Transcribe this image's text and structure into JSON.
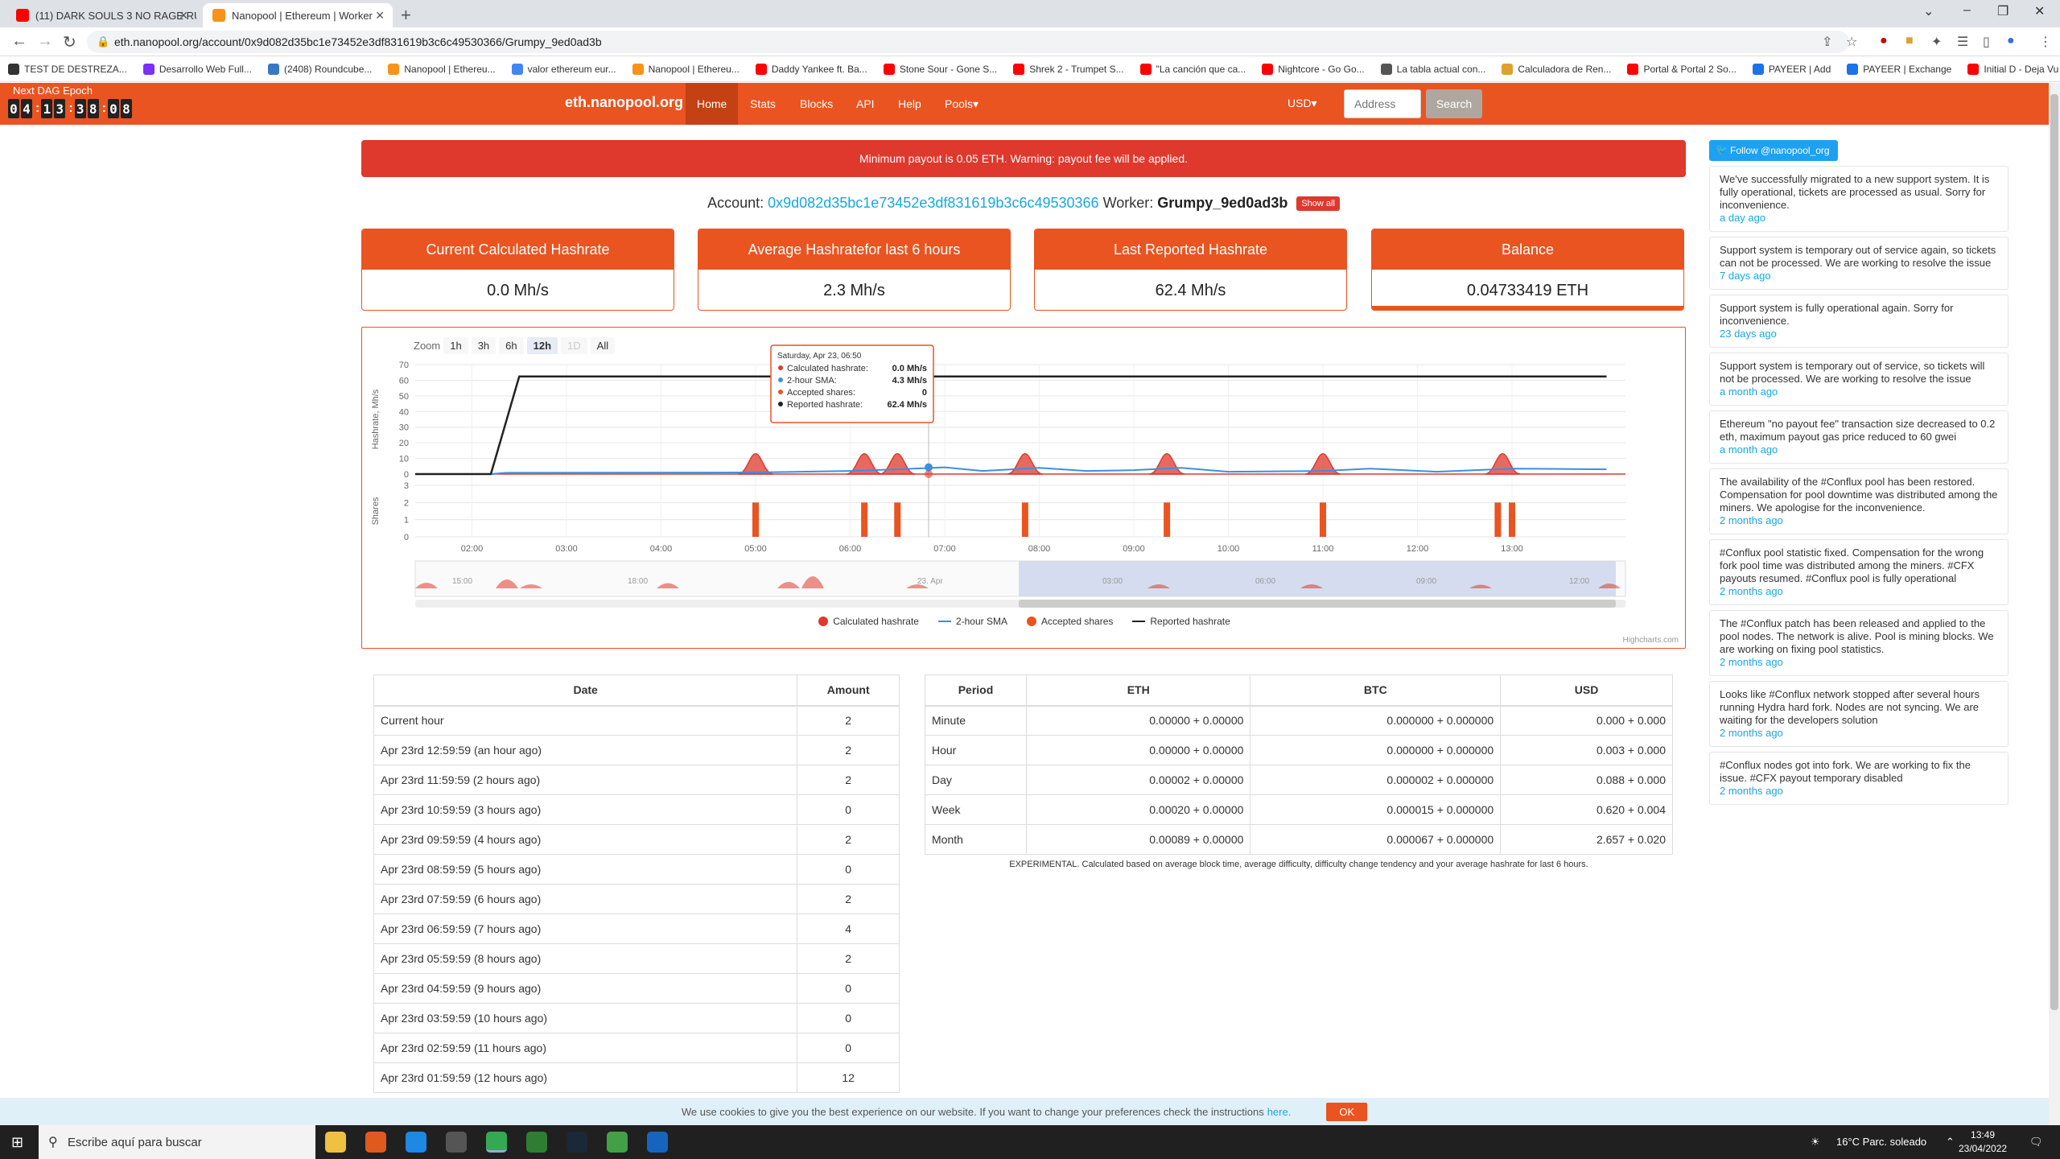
{
  "browser": {
    "tabs": [
      {
        "label": "(11) DARK SOULS 3 NO RAGE RU",
        "color": "#ff0000"
      },
      {
        "label": "Nanopool | Ethereum | Worker",
        "color": "#f7931a"
      }
    ],
    "url": "eth.nanopool.org/account/0x9d082d35bc1e73452e3df831619b3c6c49530366/Grumpy_9ed0ad3b",
    "bookmarks": [
      {
        "label": "TEST DE DESTREZA...",
        "color": "#333333"
      },
      {
        "label": "Desarrollo Web Full...",
        "color": "#7b2ff7"
      },
      {
        "label": "(2408) Roundcube...",
        "color": "#3778c2"
      },
      {
        "label": "Nanopool | Ethereu...",
        "color": "#f7931a"
      },
      {
        "label": "valor ethereum eur...",
        "color": "#4285f4"
      },
      {
        "label": "Nanopool | Ethereu...",
        "color": "#f7931a"
      },
      {
        "label": "Daddy Yankee ft. Ba...",
        "color": "#ff0000"
      },
      {
        "label": "Stone Sour - Gone S...",
        "color": "#ff0000"
      },
      {
        "label": "Shrek 2 - Trumpet S...",
        "color": "#ff0000"
      },
      {
        "label": "\"La canción que ca...",
        "color": "#ff0000"
      },
      {
        "label": "Nightcore - Go Go...",
        "color": "#ff0000"
      },
      {
        "label": "La tabla actual con...",
        "color": "#555555"
      },
      {
        "label": "Calculadora de Ren...",
        "color": "#e0a030"
      },
      {
        "label": "Portal & Portal 2 So...",
        "color": "#ff0000"
      },
      {
        "label": "PAYEER | Add",
        "color": "#1a73e8"
      },
      {
        "label": "PAYEER | Exchange",
        "color": "#1a73e8"
      },
      {
        "label": "Initial D - Deja Vu -...",
        "color": "#ff0000"
      }
    ]
  },
  "header": {
    "dag_label": "Next DAG Epoch",
    "dag_digits": [
      "0",
      "4",
      "1",
      "3",
      "3",
      "8",
      "0",
      "8"
    ],
    "brand": "eth.nanopool.org",
    "nav": [
      "Home",
      "Stats",
      "Blocks",
      "API",
      "Help",
      "Pools▾"
    ],
    "currency": "USD▾",
    "address_placeholder": "Address",
    "search_label": "Search"
  },
  "alert": "Minimum payout is 0.05 ETH. Warning: payout fee will be applied.",
  "account": {
    "label": "Account:",
    "address": "0x9d082d35bc1e73452e3df831619b3c6c49530366",
    "worker_label": "Worker:",
    "worker": "Grumpy_9ed0ad3b",
    "show_all": "Show all"
  },
  "stats": [
    {
      "title": "Current Calculated Hashrate",
      "value": "0.0 Mh/s"
    },
    {
      "title": "Average Hashrate\nfor last 6 hours",
      "value": "2.3 Mh/s"
    },
    {
      "title": "Last Reported Hashrate",
      "value": "62.4 Mh/s"
    },
    {
      "title": "Balance",
      "value": "0.04733419 ETH"
    }
  ],
  "chart_data": {
    "type": "line",
    "zoom_label": "Zoom",
    "zoom_buttons": [
      "1h",
      "3h",
      "6h",
      "12h",
      "1D",
      "All"
    ],
    "zoom_selected": "12h",
    "hashrate_axis": {
      "label": "Hashrate, Mh/s",
      "ticks": [
        0,
        10,
        20,
        30,
        40,
        50,
        60,
        70
      ],
      "ylim": [
        0,
        70
      ]
    },
    "shares_axis": {
      "label": "Shares",
      "ticks": [
        0,
        1,
        2,
        3
      ],
      "ylim": [
        0,
        3
      ]
    },
    "x_ticks": [
      "02:00",
      "03:00",
      "04:00",
      "05:00",
      "06:00",
      "07:00",
      "08:00",
      "09:00",
      "10:00",
      "11:00",
      "12:00",
      "13:00"
    ],
    "x_range": [
      1.4,
      14.2
    ],
    "series": [
      {
        "name": "Calculated hashrate",
        "color": "#df382c",
        "peaks": [
          [
            5.0,
            13
          ],
          [
            6.15,
            13
          ],
          [
            6.5,
            13
          ],
          [
            7.85,
            13
          ],
          [
            9.35,
            13
          ],
          [
            11.0,
            13
          ],
          [
            12.9,
            13
          ]
        ]
      },
      {
        "name": "2-hour SMA",
        "color": "#3d8fe0",
        "points": [
          [
            1.4,
            0
          ],
          [
            2.2,
            0
          ],
          [
            2.35,
            0.8
          ],
          [
            5.0,
            1.0
          ],
          [
            6.0,
            2.0
          ],
          [
            6.5,
            3.0
          ],
          [
            7.0,
            4.3
          ],
          [
            7.4,
            2.0
          ],
          [
            8.0,
            4.0
          ],
          [
            8.5,
            2.0
          ],
          [
            9.0,
            2.5
          ],
          [
            9.5,
            4.0
          ],
          [
            10.0,
            1.5
          ],
          [
            11.0,
            2.0
          ],
          [
            11.5,
            3.5
          ],
          [
            12.2,
            1.5
          ],
          [
            13.0,
            3.5
          ],
          [
            14.0,
            3.0
          ]
        ]
      },
      {
        "name": "Accepted shares",
        "color": "#e95420",
        "bars": [
          [
            5.0,
            2
          ],
          [
            6.15,
            2
          ],
          [
            6.5,
            2
          ],
          [
            7.85,
            2
          ],
          [
            9.35,
            2
          ],
          [
            11.0,
            2
          ],
          [
            12.85,
            2
          ],
          [
            13.0,
            2
          ]
        ]
      },
      {
        "name": "Reported hashrate",
        "color": "#222222",
        "points": [
          [
            1.4,
            0
          ],
          [
            2.2,
            0
          ],
          [
            2.5,
            62.4
          ],
          [
            14.0,
            62.4
          ]
        ]
      }
    ],
    "navigator_labels": [
      "15:00",
      "18:00",
      "23. Apr",
      "03:00",
      "06:00",
      "09:00",
      "12:00"
    ],
    "tooltip": {
      "title": "Saturday, Apr 23, 06:50",
      "rows": [
        {
          "label": "Calculated hashrate:",
          "value": "0.0 Mh/s",
          "color": "#df382c"
        },
        {
          "label": "2-hour SMA:",
          "value": "4.3 Mh/s",
          "color": "#3d8fe0"
        },
        {
          "label": "Accepted shares:",
          "value": "0",
          "color": "#e95420"
        },
        {
          "label": "Reported hashrate:",
          "value": "62.4 Mh/s",
          "color": "#222222"
        }
      ]
    },
    "credit": "Highcharts.com"
  },
  "shares_table": {
    "headers": [
      "Date",
      "Amount"
    ],
    "rows": [
      [
        "Current hour",
        "2"
      ],
      [
        "Apr 23rd 12:59:59 (an hour ago)",
        "2"
      ],
      [
        "Apr 23rd 11:59:59 (2 hours ago)",
        "2"
      ],
      [
        "Apr 23rd 10:59:59 (3 hours ago)",
        "0"
      ],
      [
        "Apr 23rd 09:59:59 (4 hours ago)",
        "2"
      ],
      [
        "Apr 23rd 08:59:59 (5 hours ago)",
        "0"
      ],
      [
        "Apr 23rd 07:59:59 (6 hours ago)",
        "2"
      ],
      [
        "Apr 23rd 06:59:59 (7 hours ago)",
        "4"
      ],
      [
        "Apr 23rd 05:59:59 (8 hours ago)",
        "2"
      ],
      [
        "Apr 23rd 04:59:59 (9 hours ago)",
        "0"
      ],
      [
        "Apr 23rd 03:59:59 (10 hours ago)",
        "0"
      ],
      [
        "Apr 23rd 02:59:59 (11 hours ago)",
        "0"
      ],
      [
        "Apr 23rd 01:59:59 (12 hours ago)",
        "12"
      ]
    ]
  },
  "earnings_table": {
    "headers": [
      "Period",
      "ETH",
      "BTC",
      "USD"
    ],
    "rows": [
      [
        "Minute",
        "0.00000 + 0.00000",
        "0.000000 + 0.000000",
        "0.000 + 0.000"
      ],
      [
        "Hour",
        "0.00000 + 0.00000",
        "0.000000 + 0.000000",
        "0.003 + 0.000"
      ],
      [
        "Day",
        "0.00002 + 0.00000",
        "0.000002 + 0.000000",
        "0.088 + 0.000"
      ],
      [
        "Week",
        "0.00020 + 0.00000",
        "0.000015 + 0.000000",
        "0.620 + 0.004"
      ],
      [
        "Month",
        "0.00089 + 0.00000",
        "0.000067 + 0.000000",
        "2.657 + 0.020"
      ]
    ],
    "note": "EXPERIMENTAL. Calculated based on average block time, average difficulty, difficulty change tendency and your average hashrate for last 6 hours."
  },
  "sidebar": {
    "follow": "Follow @nanopool_org",
    "news": [
      {
        "text": "We've successfully migrated to a new support system. It is fully operational, tickets are processed as usual. Sorry for inconvenience.",
        "ago": "a day ago"
      },
      {
        "text": "Support system is temporary out of service again, so tickets can not be processed. We are working to resolve the issue",
        "ago": "7 days ago"
      },
      {
        "text": "Support system is fully operational again. Sorry for inconvenience.",
        "ago": "23 days ago"
      },
      {
        "text": "Support system is temporary out of service, so tickets will not be processed. We are working to resolve the issue",
        "ago": "a month ago"
      },
      {
        "text": "Ethereum \"no payout fee\" transaction size decreased to 0.2 eth, maximum payout gas price reduced to 60 gwei",
        "ago": "a month ago"
      },
      {
        "text": "The availability of the #Conflux pool has been restored. Compensation for pool downtime was distributed among the miners. We apologise for the inconvenience.",
        "ago": "2 months ago"
      },
      {
        "text": "#Conflux pool statistic fixed. Compensation for the wrong fork pool time was distributed among the miners. #CFX payouts resumed. #Conflux pool is fully operational",
        "ago": "2 months ago"
      },
      {
        "text": "The #Conflux patch has been released and applied to the pool nodes. The network is alive. Pool is mining blocks. We are working on fixing pool statistics.",
        "ago": "2 months ago"
      },
      {
        "text": "Looks like #Conflux network stopped after several hours running Hydra hard fork. Nodes are not syncing. We are waiting for the developers solution",
        "ago": "2 months ago"
      },
      {
        "text": "#Conflux nodes got into fork. We are working to fix the issue. #CFX payout temporary disabled",
        "ago": "2 months ago"
      }
    ]
  },
  "cookie": {
    "text": "We use cookies to give you the best experience on our website. If you want to change your preferences check the instructions",
    "link": "here.",
    "ok": "OK"
  },
  "taskbar": {
    "search_placeholder": "Escribe aquí para buscar",
    "weather": "16°C  Parc. soleado",
    "time": "13:49",
    "date": "23/04/2022"
  }
}
